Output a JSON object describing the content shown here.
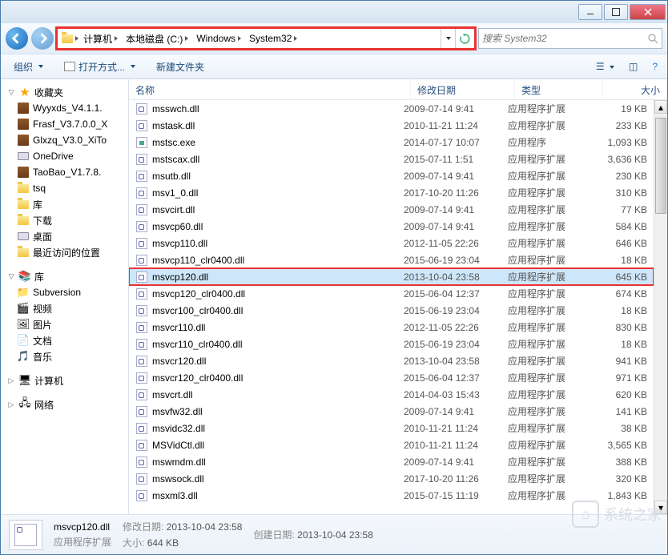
{
  "window": {
    "breadcrumbs": [
      "计算机",
      "本地磁盘 (C:)",
      "Windows",
      "System32"
    ],
    "search_placeholder": "搜索 System32"
  },
  "toolbar": {
    "organize": "组织",
    "open_with": "打开方式...",
    "new_folder": "新建文件夹"
  },
  "tree": {
    "favorites": "收藏夹",
    "fav_items": [
      "Wyyxds_V4.1.1.",
      "Frasf_V3.7.0.0_X",
      "Glxzq_V3.0_XiTo",
      "OneDrive",
      "TaoBao_V1.7.8.",
      "tsq",
      "库",
      "下载",
      "桌面",
      "最近访问的位置"
    ],
    "libraries": "库",
    "lib_items": [
      "Subversion",
      "视频",
      "图片",
      "文档",
      "音乐"
    ],
    "computer": "计算机",
    "network": "网络"
  },
  "columns": {
    "name": "名称",
    "date": "修改日期",
    "type": "类型",
    "size": "大小"
  },
  "files": [
    {
      "n": "msswch.dll",
      "d": "2009-07-14 9:41",
      "t": "应用程序扩展",
      "s": "19 KB"
    },
    {
      "n": "mstask.dll",
      "d": "2010-11-21 11:24",
      "t": "应用程序扩展",
      "s": "233 KB"
    },
    {
      "n": "mstsc.exe",
      "d": "2014-07-17 10:07",
      "t": "应用程序",
      "s": "1,093 KB",
      "exe": true
    },
    {
      "n": "mstscax.dll",
      "d": "2015-07-11 1:51",
      "t": "应用程序扩展",
      "s": "3,636 KB"
    },
    {
      "n": "msutb.dll",
      "d": "2009-07-14 9:41",
      "t": "应用程序扩展",
      "s": "230 KB"
    },
    {
      "n": "msv1_0.dll",
      "d": "2017-10-20 11:26",
      "t": "应用程序扩展",
      "s": "310 KB"
    },
    {
      "n": "msvcirt.dll",
      "d": "2009-07-14 9:41",
      "t": "应用程序扩展",
      "s": "77 KB"
    },
    {
      "n": "msvcp60.dll",
      "d": "2009-07-14 9:41",
      "t": "应用程序扩展",
      "s": "584 KB"
    },
    {
      "n": "msvcp110.dll",
      "d": "2012-11-05 22:26",
      "t": "应用程序扩展",
      "s": "646 KB"
    },
    {
      "n": "msvcp110_clr0400.dll",
      "d": "2015-06-19 23:04",
      "t": "应用程序扩展",
      "s": "18 KB"
    },
    {
      "n": "msvcp120.dll",
      "d": "2013-10-04 23:58",
      "t": "应用程序扩展",
      "s": "645 KB",
      "sel": true
    },
    {
      "n": "msvcp120_clr0400.dll",
      "d": "2015-06-04 12:37",
      "t": "应用程序扩展",
      "s": "674 KB"
    },
    {
      "n": "msvcr100_clr0400.dll",
      "d": "2015-06-19 23:04",
      "t": "应用程序扩展",
      "s": "18 KB"
    },
    {
      "n": "msvcr110.dll",
      "d": "2012-11-05 22:26",
      "t": "应用程序扩展",
      "s": "830 KB"
    },
    {
      "n": "msvcr110_clr0400.dll",
      "d": "2015-06-19 23:04",
      "t": "应用程序扩展",
      "s": "18 KB"
    },
    {
      "n": "msvcr120.dll",
      "d": "2013-10-04 23:58",
      "t": "应用程序扩展",
      "s": "941 KB"
    },
    {
      "n": "msvcr120_clr0400.dll",
      "d": "2015-06-04 12:37",
      "t": "应用程序扩展",
      "s": "971 KB"
    },
    {
      "n": "msvcrt.dll",
      "d": "2014-04-03 15:43",
      "t": "应用程序扩展",
      "s": "620 KB"
    },
    {
      "n": "msvfw32.dll",
      "d": "2009-07-14 9:41",
      "t": "应用程序扩展",
      "s": "141 KB"
    },
    {
      "n": "msvidc32.dll",
      "d": "2010-11-21 11:24",
      "t": "应用程序扩展",
      "s": "38 KB"
    },
    {
      "n": "MSVidCtl.dll",
      "d": "2010-11-21 11:24",
      "t": "应用程序扩展",
      "s": "3,565 KB"
    },
    {
      "n": "mswmdm.dll",
      "d": "2009-07-14 9:41",
      "t": "应用程序扩展",
      "s": "388 KB"
    },
    {
      "n": "mswsock.dll",
      "d": "2017-10-20 11:26",
      "t": "应用程序扩展",
      "s": "320 KB"
    },
    {
      "n": "msxml3.dll",
      "d": "2015-07-15 11:19",
      "t": "应用程序扩展",
      "s": "1,843 KB"
    }
  ],
  "status": {
    "name": "msvcp120.dll",
    "type": "应用程序扩展",
    "mod_label": "修改日期:",
    "mod_val": "2013-10-04 23:58",
    "size_label": "大小:",
    "size_val": "644 KB",
    "create_label": "创建日期:",
    "create_val": "2013-10-04 23:58"
  },
  "watermark": "系统之家"
}
